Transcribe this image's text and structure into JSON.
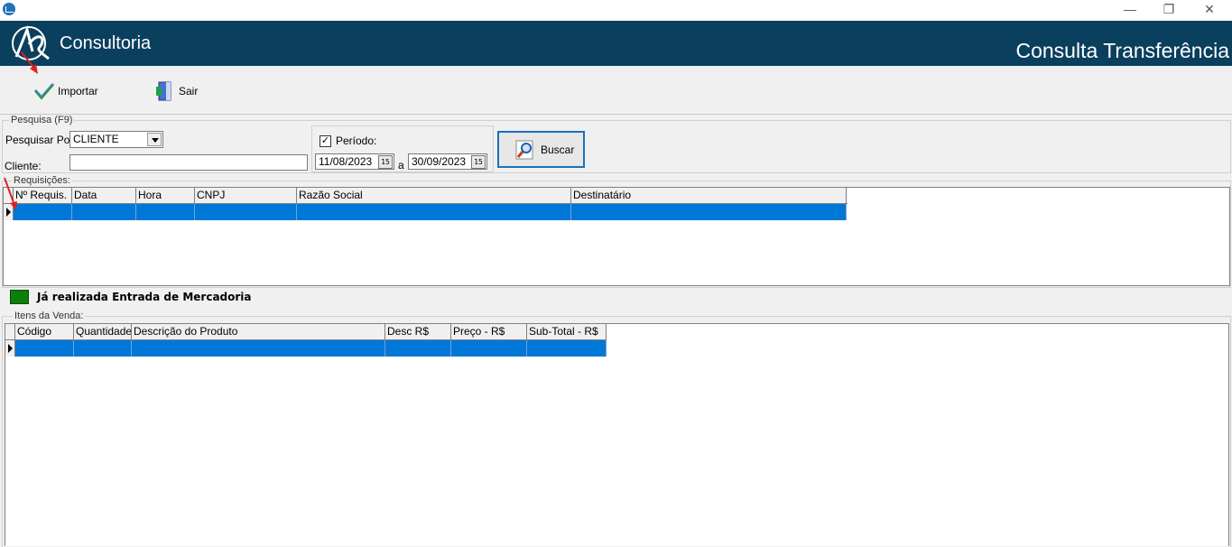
{
  "window": {
    "minimize": "—",
    "restore": "❐",
    "close": "✕"
  },
  "header": {
    "brand": "Consultoria",
    "title": "Consulta Transferência"
  },
  "toolbar": {
    "import_label": "Importar",
    "exit_label": "Sair"
  },
  "search": {
    "group_label": "Pesquisa (F9)",
    "search_by_label": "Pesquisar Por:",
    "search_by_value": "CLIENTE",
    "client_label": "Cliente:",
    "client_value": "",
    "period_label": "Período:",
    "period_checked": "✓",
    "date_from": "11/08/2023",
    "date_sep": "a",
    "date_to": "30/09/2023",
    "calendar_glyph": "15",
    "search_button": "Buscar"
  },
  "requisitions": {
    "group_label": "Requisições:",
    "columns": [
      "Nº Requis.",
      "Data",
      "Hora",
      "CNPJ",
      "Razão Social",
      "Destinatário"
    ]
  },
  "legend": {
    "text": "Já realizada Entrada de Mercadoria",
    "color": "#0a7f0a"
  },
  "items": {
    "group_label": "Itens da Venda:",
    "columns": [
      "Código",
      "Quantidade",
      "Descrição do Produto",
      "Desc R$",
      "Preço - R$",
      "Sub-Total - R$"
    ]
  },
  "colors": {
    "header_bg": "#0b3f5e",
    "selection": "#0078d7",
    "annotation_arrow": "#e02020"
  }
}
